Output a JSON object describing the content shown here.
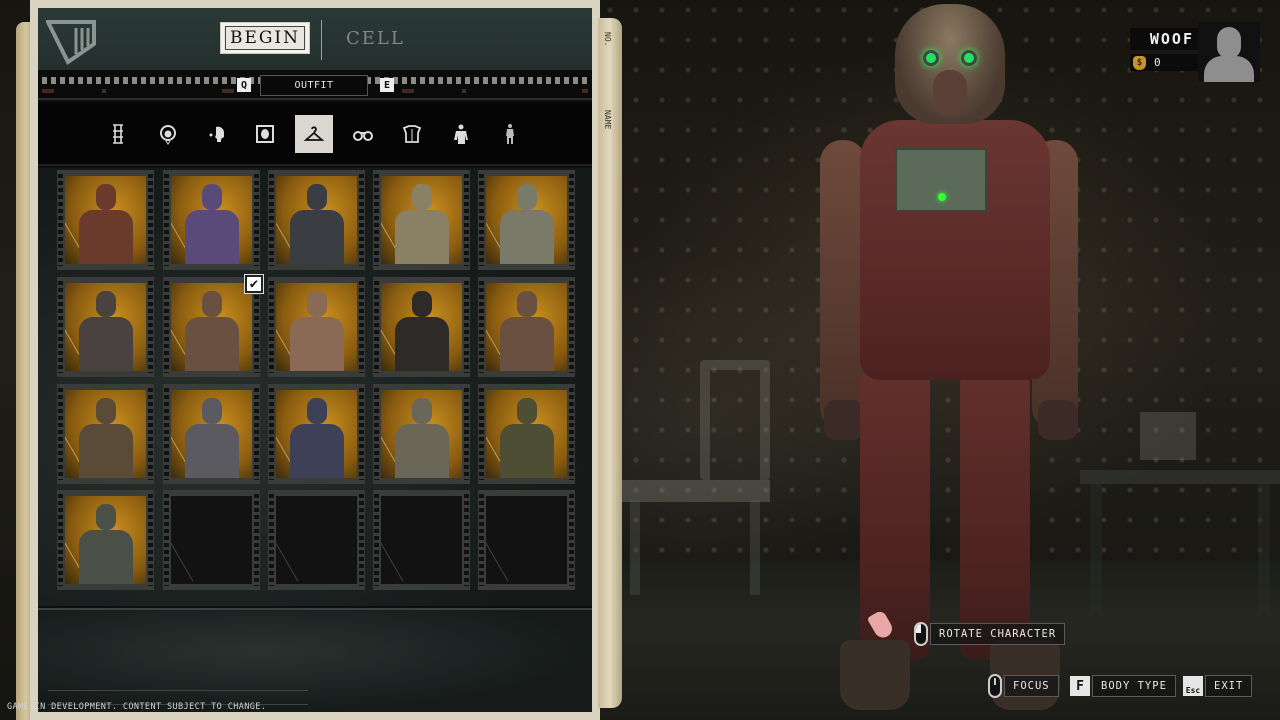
{
  "header": {
    "logo": "game-logo",
    "tabs": [
      {
        "label": "BEGIN",
        "active": true
      },
      {
        "label": "CELL",
        "active": false
      }
    ]
  },
  "subnav": {
    "prev_key": "Q",
    "next_key": "E",
    "current": "OUTFIT"
  },
  "categories": [
    {
      "name": "dna-icon",
      "active": false
    },
    {
      "name": "hood-head-icon",
      "active": false
    },
    {
      "name": "voice-head-icon",
      "active": false
    },
    {
      "name": "portrait-icon",
      "active": false
    },
    {
      "name": "hanger-icon",
      "active": true
    },
    {
      "name": "binoculars-icon",
      "active": false
    },
    {
      "name": "torso-armor-icon",
      "active": false
    },
    {
      "name": "upper-body-icon",
      "active": false
    },
    {
      "name": "full-body-icon",
      "active": false
    }
  ],
  "outfits": {
    "columns": 5,
    "items": [
      {
        "filled": true,
        "selected": false,
        "tint": "#6a3a2c"
      },
      {
        "filled": true,
        "selected": false,
        "tint": "#5a4a7a"
      },
      {
        "filled": true,
        "selected": false,
        "tint": "#3a3e42"
      },
      {
        "filled": true,
        "selected": false,
        "tint": "#8a8066"
      },
      {
        "filled": true,
        "selected": false,
        "tint": "#7a7a68"
      },
      {
        "filled": true,
        "selected": false,
        "tint": "#4a4240"
      },
      {
        "filled": true,
        "selected": true,
        "tint": "#6a5040"
      },
      {
        "filled": true,
        "selected": false,
        "tint": "#8a6a54"
      },
      {
        "filled": true,
        "selected": false,
        "tint": "#2e2a28"
      },
      {
        "filled": true,
        "selected": false,
        "tint": "#6a5040"
      },
      {
        "filled": true,
        "selected": false,
        "tint": "#5a4a38"
      },
      {
        "filled": true,
        "selected": false,
        "tint": "#5a5a60"
      },
      {
        "filled": true,
        "selected": false,
        "tint": "#3e4058"
      },
      {
        "filled": true,
        "selected": false,
        "tint": "#6a6658"
      },
      {
        "filled": true,
        "selected": false,
        "tint": "#4e4e34"
      },
      {
        "filled": true,
        "selected": false,
        "tint": "#4a5048"
      },
      {
        "filled": false,
        "selected": false,
        "tint": ""
      },
      {
        "filled": false,
        "selected": false,
        "tint": ""
      },
      {
        "filled": false,
        "selected": false,
        "tint": ""
      },
      {
        "filled": false,
        "selected": false,
        "tint": ""
      }
    ],
    "check_glyph": "✔"
  },
  "spine": {
    "right_top": "NO.",
    "right_mid": "NAME"
  },
  "disclaimer": "GAME IN DEVELOPMENT. CONTENT SUBJECT TO CHANGE.",
  "player": {
    "name": "WOOF",
    "currency_icon": "$",
    "currency": "0"
  },
  "hints": {
    "rotate": {
      "icon": "mouse-left-icon",
      "label": "ROTATE CHARACTER"
    },
    "focus": {
      "icon": "mouse-icon",
      "label": "FOCUS"
    },
    "body_type": {
      "key": "F",
      "label": "BODY TYPE"
    },
    "exit": {
      "key": "Esc",
      "label": "EXIT"
    }
  }
}
